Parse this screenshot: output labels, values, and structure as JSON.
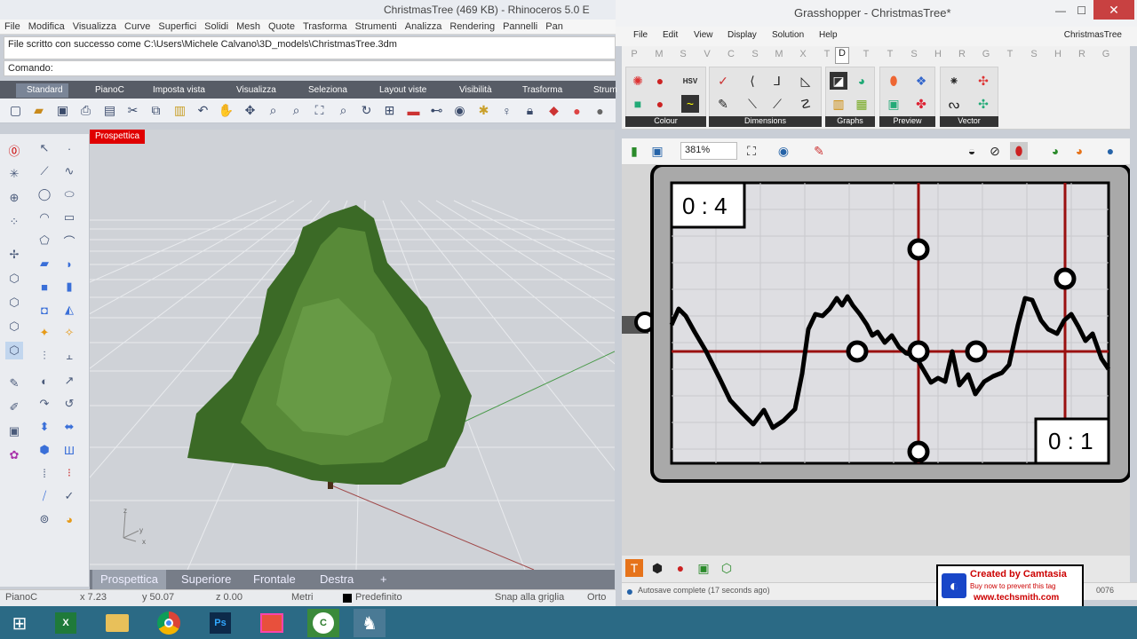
{
  "rhino": {
    "title": "ChristmasTree (469 KB) - Rhinoceros 5.0 E",
    "menu": [
      "File",
      "Modifica",
      "Visualizza",
      "Curve",
      "Superfici",
      "Solidi",
      "Mesh",
      "Quote",
      "Trasforma",
      "Strumenti",
      "Analizza",
      "Rendering",
      "Pannelli",
      "Pan"
    ],
    "command_history": "File scritto con successo come C:\\Users\\Michele Calvano\\3D_models\\ChristmasTree.3dm",
    "command_prompt": "Comando:",
    "toolbar_tabs": [
      "Standard",
      "PianoC",
      "Imposta vista",
      "Visualizza",
      "Seleziona",
      "Layout viste",
      "Visibilità",
      "Trasforma",
      "Strum"
    ],
    "viewport_label": "Prospettica",
    "viewport_tabs": [
      "Prospettica",
      "Superiore",
      "Frontale",
      "Destra"
    ],
    "axes": {
      "x": "x",
      "y": "y",
      "z": "z"
    },
    "status": {
      "cplane": "PianoC",
      "x": "x 7.23",
      "y": "y 50.07",
      "z": "z 0.00",
      "units": "Metri",
      "layer": "Predefinito",
      "snap": "Snap alla griglia",
      "ortho": "Orto"
    }
  },
  "grasshopper": {
    "title": "Grasshopper - ChristmasTree*",
    "menu": [
      "File",
      "Edit",
      "View",
      "Display",
      "Solution",
      "Help"
    ],
    "document_name": "ChristmasTree",
    "category_tabs": [
      "P",
      "M",
      "S",
      "V",
      "C",
      "S",
      "M",
      "X",
      "T",
      "D",
      "T",
      "T",
      "S",
      "H",
      "R",
      "G",
      "T",
      "S",
      "H",
      "R",
      "G"
    ],
    "active_category": "D",
    "panel_groups": [
      "Colour",
      "Dimensions",
      "Graphs",
      "Preview",
      "Vector"
    ],
    "zoom": "381%",
    "graph_mapper": {
      "label_min": "0 : 4",
      "label_max": "0 : 1"
    },
    "status": "Autosave complete (17 seconds ago)",
    "status_right": "0076"
  },
  "camtasia": {
    "line1": "Created by Camtasia",
    "line2": "Buy now to prevent this tag",
    "line3": "www.techsmith.com"
  },
  "taskbar": {
    "apps": [
      "windows-start",
      "excel",
      "file-explorer",
      "chrome",
      "photoshop",
      "camera-app",
      "camtasia",
      "rhino"
    ]
  }
}
